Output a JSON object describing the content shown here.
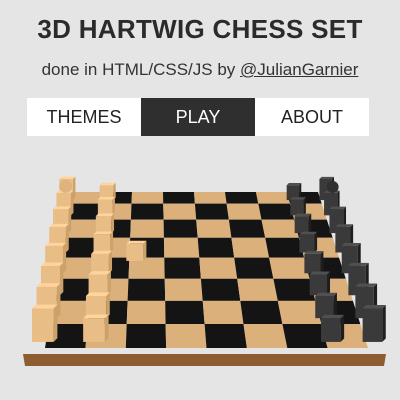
{
  "header": {
    "title": "3D HARTWIG CHESS SET",
    "subtitle_prefix": "done in HTML/CSS/JS by ",
    "author_link": "@JulianGarnier"
  },
  "nav": {
    "tabs": [
      {
        "label": "THEMES",
        "active": false
      },
      {
        "label": "PLAY",
        "active": true
      },
      {
        "label": "ABOUT",
        "active": false
      }
    ]
  },
  "colors": {
    "background": "#e5e5e5",
    "light_square": "#dcb07a",
    "dark_square": "#141414",
    "board_frame": "#b07a45",
    "light_piece": "#e9bd86",
    "dark_piece": "#3a3a3a",
    "active_tab": "#2f2f2f"
  }
}
